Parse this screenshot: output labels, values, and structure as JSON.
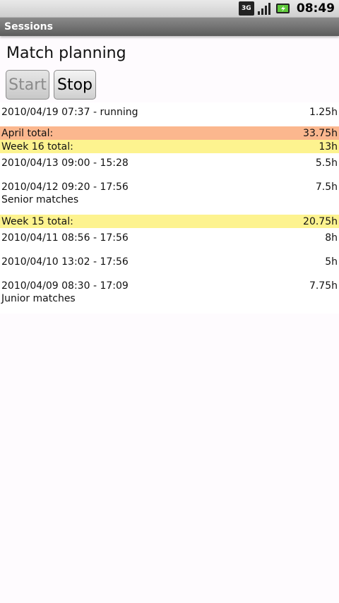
{
  "status_bar": {
    "network": "3G",
    "time": "08:49"
  },
  "app": {
    "title": "Sessions",
    "heading": "Match planning",
    "buttons": {
      "start": "Start",
      "stop": "Stop"
    }
  },
  "entries": [
    {
      "type": "session",
      "text": "2010/04/19 07:37 - running",
      "value": "1.25h",
      "note": ""
    },
    {
      "type": "month_total",
      "text": "April total:",
      "value": "33.75h"
    },
    {
      "type": "week_total",
      "text": "Week 16 total:",
      "value": "13h"
    },
    {
      "type": "session",
      "text": "2010/04/13 09:00 - 15:28",
      "value": "5.5h",
      "note": ""
    },
    {
      "type": "session",
      "text": "2010/04/12 09:20 - 17:56",
      "value": "7.5h",
      "note": "Senior matches"
    },
    {
      "type": "week_total",
      "text": "Week 15 total:",
      "value": "20.75h"
    },
    {
      "type": "session",
      "text": "2010/04/11 08:56 - 17:56",
      "value": "8h",
      "note": ""
    },
    {
      "type": "session",
      "text": "2010/04/10 13:02 - 17:56",
      "value": "5h",
      "note": ""
    },
    {
      "type": "session",
      "text": "2010/04/09 08:30 - 17:09",
      "value": "7.75h",
      "note": "Junior matches"
    }
  ]
}
